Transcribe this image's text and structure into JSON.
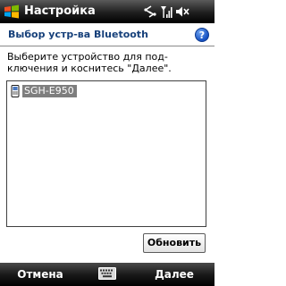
{
  "titlebar": {
    "app_title": "Настройка",
    "icons": [
      "windows-start-icon",
      "connectivity-icon",
      "signal-strength-icon",
      "volume-muted-icon"
    ]
  },
  "page": {
    "title": "Выбор устр-ва Bluetooth",
    "help_icon": "help-icon",
    "help_glyph": "?",
    "instruction": "Выберите устройство для под-ключения и коснитесь \"Далее\"."
  },
  "device_list": {
    "items": [
      {
        "icon": "phone-icon",
        "name": "SGH-E950",
        "selected": true
      }
    ]
  },
  "buttons": {
    "refresh_label": "Обновить"
  },
  "softkeys": {
    "left": "Отмена",
    "center_icon": "keyboard-icon",
    "right": "Далее"
  },
  "colors": {
    "title_text": "#16407a",
    "selection": "#7e7e7e",
    "bar_background": "#000000"
  }
}
